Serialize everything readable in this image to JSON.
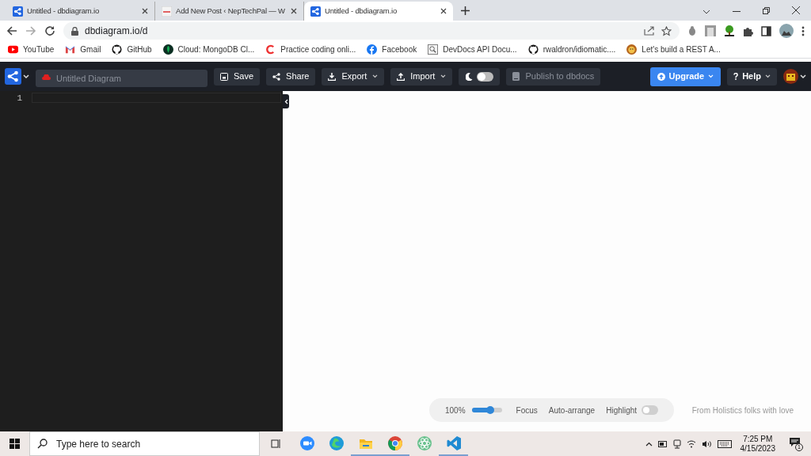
{
  "browser": {
    "tabs": [
      {
        "title": "Untitled - dbdiagram.io",
        "kind": "app",
        "selected": false
      },
      {
        "title": "Add New Post ‹ NepTechPal — W",
        "kind": "site",
        "selected": false
      },
      {
        "title": "Untitled - dbdiagram.io",
        "kind": "app",
        "selected": true
      }
    ],
    "address": "dbdiagram.io/d",
    "bookmarks": [
      {
        "label": "YouTube",
        "kind": "video"
      },
      {
        "label": "Gmail",
        "kind": "mail"
      },
      {
        "label": "GitHub",
        "kind": "code"
      },
      {
        "label": "Cloud: MongoDB Cl...",
        "kind": "leaf"
      },
      {
        "label": "Practice coding onli...",
        "kind": "letter"
      },
      {
        "label": "Facebook",
        "kind": "social"
      },
      {
        "label": "DevDocs API Docu...",
        "kind": "docs"
      },
      {
        "label": "rwaldron/idiomatic....",
        "kind": "code"
      },
      {
        "label": "Let's build a REST A...",
        "kind": "lion"
      }
    ]
  },
  "app": {
    "diagram_name_placeholder": "Untitled Diagram",
    "buttons": [
      {
        "label": "Save",
        "kind": "save",
        "caret": false
      },
      {
        "label": "Share",
        "kind": "share",
        "caret": false
      },
      {
        "label": "Export",
        "kind": "download",
        "caret": true
      },
      {
        "label": "Import",
        "kind": "upload",
        "caret": true
      }
    ],
    "dark_mode": {
      "on": false
    },
    "publish": {
      "label": "Publish to dbdocs",
      "disabled": true
    },
    "upgrade": {
      "label": "Upgrade"
    },
    "help": {
      "label": "Help"
    },
    "editor": {
      "line_numbers": [
        "1"
      ]
    },
    "canvas_toolbar": {
      "zoom": "100%",
      "level": 0.62,
      "focus": "Focus",
      "auto_arrange": "Auto-arrange",
      "highlight": {
        "label": "Highlight",
        "on": false
      }
    },
    "footer": "From Holistics folks with love"
  },
  "taskbar": {
    "search_placeholder": "Type here to search",
    "apps": [
      {
        "kind": "meeting",
        "active": false
      },
      {
        "kind": "browser-wave",
        "active": false
      },
      {
        "kind": "folder",
        "active": true
      },
      {
        "kind": "browser-ring",
        "active": true
      },
      {
        "kind": "atom",
        "active": false
      },
      {
        "kind": "editor",
        "active": true
      }
    ],
    "time": "7:25 PM",
    "date": "4/15/2023",
    "notifications": "1"
  }
}
